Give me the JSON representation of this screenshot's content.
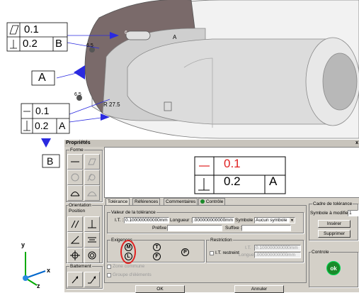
{
  "viewport": {
    "fcf_top": {
      "row1_value": "0.1",
      "row2_value": "0.2",
      "row2_ref": "B"
    },
    "datum_label": "A",
    "fcf_bottom": {
      "row1_value": "0.1",
      "row2_value": "0.2",
      "row2_ref": "A"
    },
    "datum_label_b": "B",
    "radius_label": "R 27.5",
    "small_label_1": "6",
    "small_label_2": "6.5",
    "small_label_3": "6.5",
    "model_letter": "A",
    "axis_y": "y",
    "axis_x": "x",
    "axis_z": "z"
  },
  "dialog": {
    "title": "Propriétés",
    "close_label": "x",
    "forme_label": "Forme",
    "orientation_label": "Orientation",
    "position_label": "Position",
    "battement_label": "Battement",
    "preview": {
      "row1_value": "0.1",
      "row2_value": "0.2",
      "row2_ref": "A"
    },
    "tabs": [
      "Tolérance",
      "Références",
      "Commentaires",
      "Contrôle"
    ],
    "valeur_group": "Valeur de la tolérance",
    "it_label": "I.T. :",
    "it_value": "0.100000000000mm",
    "longueur_label": "Longueur :",
    "longueur_value": ".000000000000mm",
    "symbole_label": "Symbole :",
    "symbole_value": "Aucun symbole",
    "prefixe_label": "Préfixe :",
    "suffixe_label": "Suffixe :",
    "exigences_label": "Exigences",
    "modifiers": [
      "M",
      "T",
      "P",
      "L",
      "F"
    ],
    "restriction_label": "Restriction",
    "it_restreint_label": "I.T. restreint",
    "it_restreint_value": "0.100000000000mm",
    "longueur_restreint_value": ".000000000000mm",
    "it_small": "I.T.",
    "longueur_small": "Longueur",
    "zone_commune": "Zone commune",
    "groupe_elements": "Groupe d'éléments",
    "cadre_label": "Cadre de tolérance",
    "symbole_modifier_label": "Symbole à modifier :",
    "symbole_modifier_value": "1",
    "inserer": "Insérer",
    "supprimer": "Supprimer",
    "controle_label": "Controle",
    "ok_icon": "ok",
    "ok_button": "OK",
    "annuler_button": "Annuler"
  },
  "colors": {
    "accent": "#2a2ae0",
    "red": "#e02020",
    "ok_green": "#1a8a2a"
  }
}
